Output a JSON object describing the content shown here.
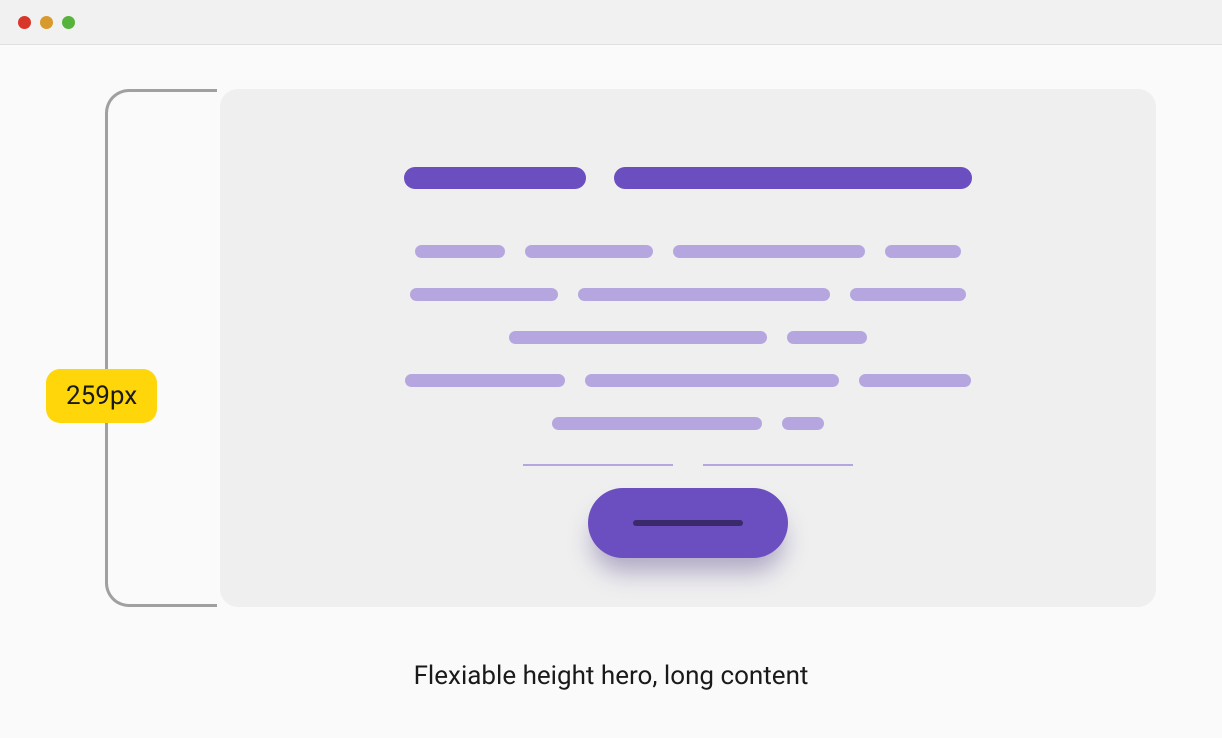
{
  "measurement": {
    "label": "259px"
  },
  "caption": "Flexiable height hero, long content",
  "colors": {
    "accent": "#6b4ec0",
    "accent_light": "#b6a6e0",
    "badge": "#ffd60a",
    "card_bg": "#efefef"
  },
  "hero": {
    "title_bars": [
      182,
      358
    ],
    "body_rows": [
      [
        90,
        128,
        192,
        76
      ],
      [
        148,
        252,
        116
      ],
      [
        258,
        80
      ],
      [
        160,
        254,
        112
      ],
      [
        210,
        42
      ]
    ]
  }
}
